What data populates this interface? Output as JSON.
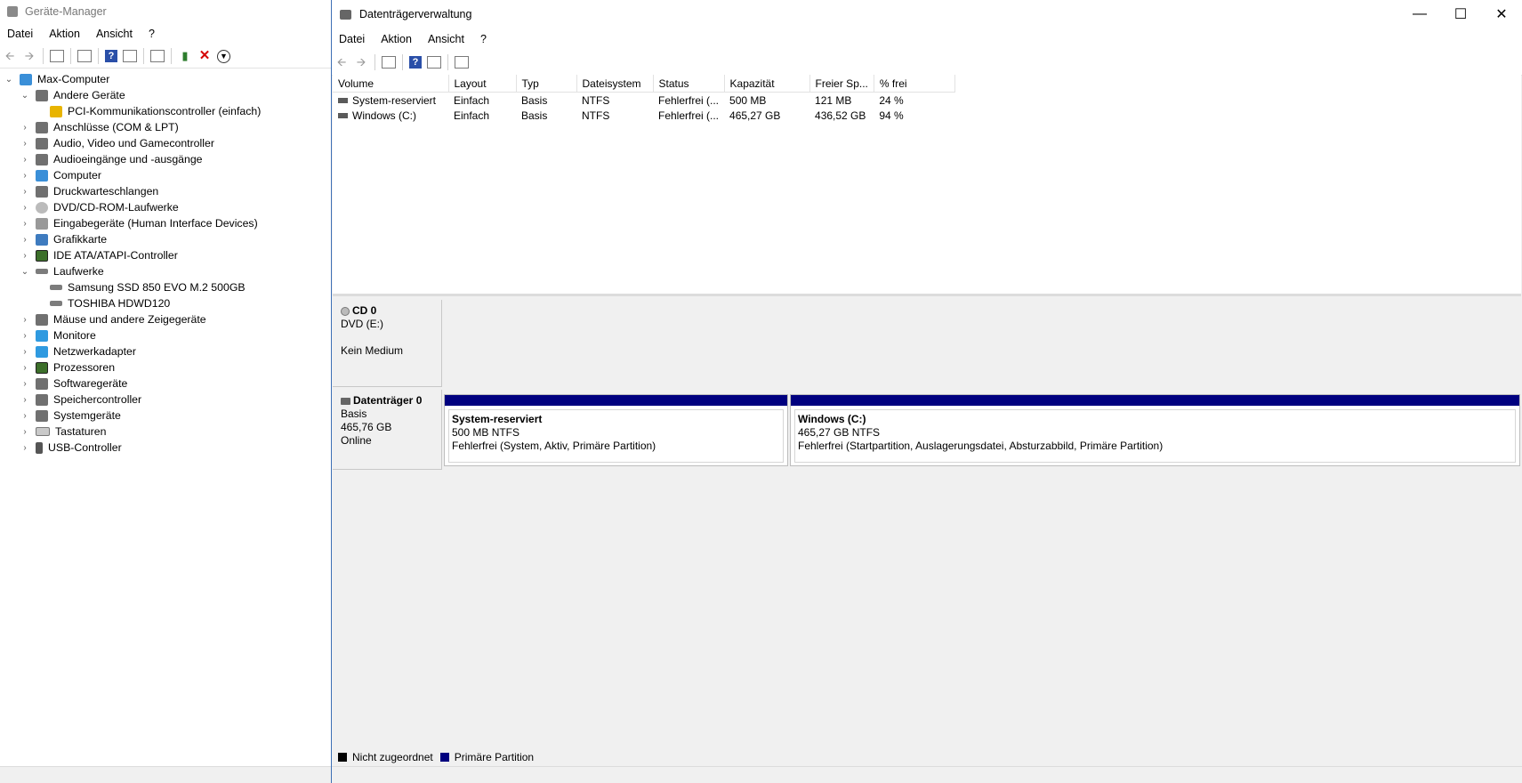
{
  "device_manager": {
    "title": "Geräte-Manager",
    "menu": [
      "Datei",
      "Aktion",
      "Ansicht",
      "?"
    ],
    "root": "Max-Computer",
    "tree": [
      {
        "label": "Andere Geräte",
        "expanded": true,
        "icon": "unknown-device-icon"
      },
      {
        "label": "PCI-Kommunikationscontroller (einfach)",
        "child": true,
        "icon": "warning-device-icon"
      },
      {
        "label": "Anschlüsse (COM & LPT)",
        "icon": "port-icon"
      },
      {
        "label": "Audio, Video und Gamecontroller",
        "icon": "speaker-icon"
      },
      {
        "label": "Audioeingänge und -ausgänge",
        "icon": "speaker-icon"
      },
      {
        "label": "Computer",
        "icon": "computer-icon"
      },
      {
        "label": "Druckwarteschlangen",
        "icon": "printer-icon"
      },
      {
        "label": "DVD/CD-ROM-Laufwerke",
        "icon": "dvd-icon"
      },
      {
        "label": "Eingabegeräte (Human Interface Devices)",
        "icon": "hid-icon"
      },
      {
        "label": "Grafikkarte",
        "icon": "gpu-icon"
      },
      {
        "label": "IDE ATA/ATAPI-Controller",
        "icon": "ide-controller-icon"
      },
      {
        "label": "Laufwerke",
        "expanded": true,
        "icon": "disk-drive-icon"
      },
      {
        "label": "Samsung SSD 850 EVO M.2 500GB",
        "child": true,
        "icon": "disk-drive-icon"
      },
      {
        "label": "TOSHIBA HDWD120",
        "child": true,
        "icon": "disk-drive-icon"
      },
      {
        "label": "Mäuse und andere Zeigegeräte",
        "icon": "mouse-icon"
      },
      {
        "label": "Monitore",
        "icon": "monitor-icon"
      },
      {
        "label": "Netzwerkadapter",
        "icon": "network-adapter-icon"
      },
      {
        "label": "Prozessoren",
        "icon": "processor-icon"
      },
      {
        "label": "Softwaregeräte",
        "icon": "software-device-icon"
      },
      {
        "label": "Speichercontroller",
        "icon": "storage-controller-icon"
      },
      {
        "label": "Systemgeräte",
        "icon": "system-device-icon"
      },
      {
        "label": "Tastaturen",
        "icon": "keyboard-icon"
      },
      {
        "label": "USB-Controller",
        "icon": "usb-icon"
      }
    ]
  },
  "disk_management": {
    "title": "Datenträgerverwaltung",
    "menu": [
      "Datei",
      "Aktion",
      "Ansicht",
      "?"
    ],
    "columns": [
      "Volume",
      "Layout",
      "Typ",
      "Dateisystem",
      "Status",
      "Kapazität",
      "Freier Sp...",
      "% frei"
    ],
    "volumes": [
      [
        "System-reserviert",
        "Einfach",
        "Basis",
        "NTFS",
        "Fehlerfrei (...",
        "500 MB",
        "121 MB",
        "24 %"
      ],
      [
        "Windows (C:)",
        "Einfach",
        "Basis",
        "NTFS",
        "Fehlerfrei (...",
        "465,27 GB",
        "436,52 GB",
        "94 %"
      ]
    ],
    "cd": {
      "name": "CD 0",
      "drive": "DVD (E:)",
      "media": "Kein Medium"
    },
    "disk0": {
      "name": "Datenträger 0",
      "type": "Basis",
      "size": "465,76 GB",
      "state": "Online",
      "partitions": [
        {
          "name": "System-reserviert",
          "size": "500 MB NTFS",
          "status": "Fehlerfrei (System, Aktiv, Primäre Partition)"
        },
        {
          "name": "Windows  (C:)",
          "size": "465,27 GB NTFS",
          "status": "Fehlerfrei (Startpartition, Auslagerungsdatei, Absturzabbild, Primäre Partition)"
        }
      ]
    },
    "legend": [
      {
        "label": "Nicht zugeordnet",
        "color": "#000000"
      },
      {
        "label": "Primäre Partition",
        "color": "#00007f"
      }
    ]
  }
}
